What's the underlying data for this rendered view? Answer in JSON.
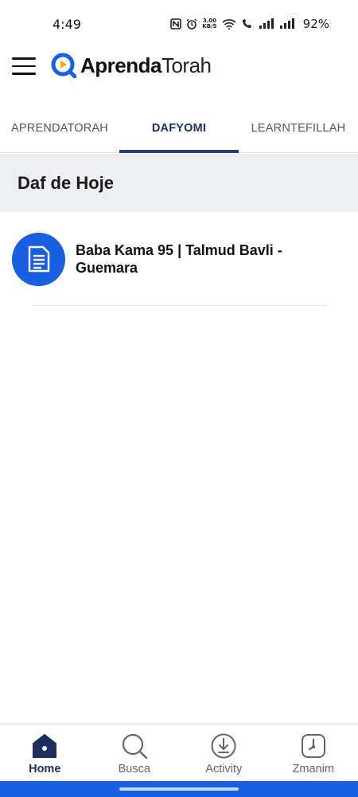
{
  "status_bar": {
    "time": "4:49",
    "speed_value": "3.00",
    "speed_unit": "KB/S",
    "battery": "92%"
  },
  "header": {
    "logo_bold": "Aprenda",
    "logo_light": "Torah",
    "brand_color": "#1a5fe0",
    "logo_accent": "#f5a623"
  },
  "tabs": [
    {
      "label": "APRENDATORAH",
      "active": false
    },
    {
      "label": "DAFYOMI",
      "active": true
    },
    {
      "label": "LEARNTEFILLAH",
      "active": false
    }
  ],
  "section": {
    "title": "Daf de Hoje"
  },
  "items": [
    {
      "title": "Baba Kama 95 | Talmud Bavli - Guemara",
      "icon": "document-icon"
    }
  ],
  "bottom_nav": [
    {
      "label": "Home",
      "icon": "home-icon",
      "active": true
    },
    {
      "label": "Busca",
      "icon": "search-icon",
      "active": false
    },
    {
      "label": "Activity",
      "icon": "download-icon",
      "active": false
    },
    {
      "label": "Zmanim",
      "icon": "clock-icon",
      "active": false
    }
  ]
}
